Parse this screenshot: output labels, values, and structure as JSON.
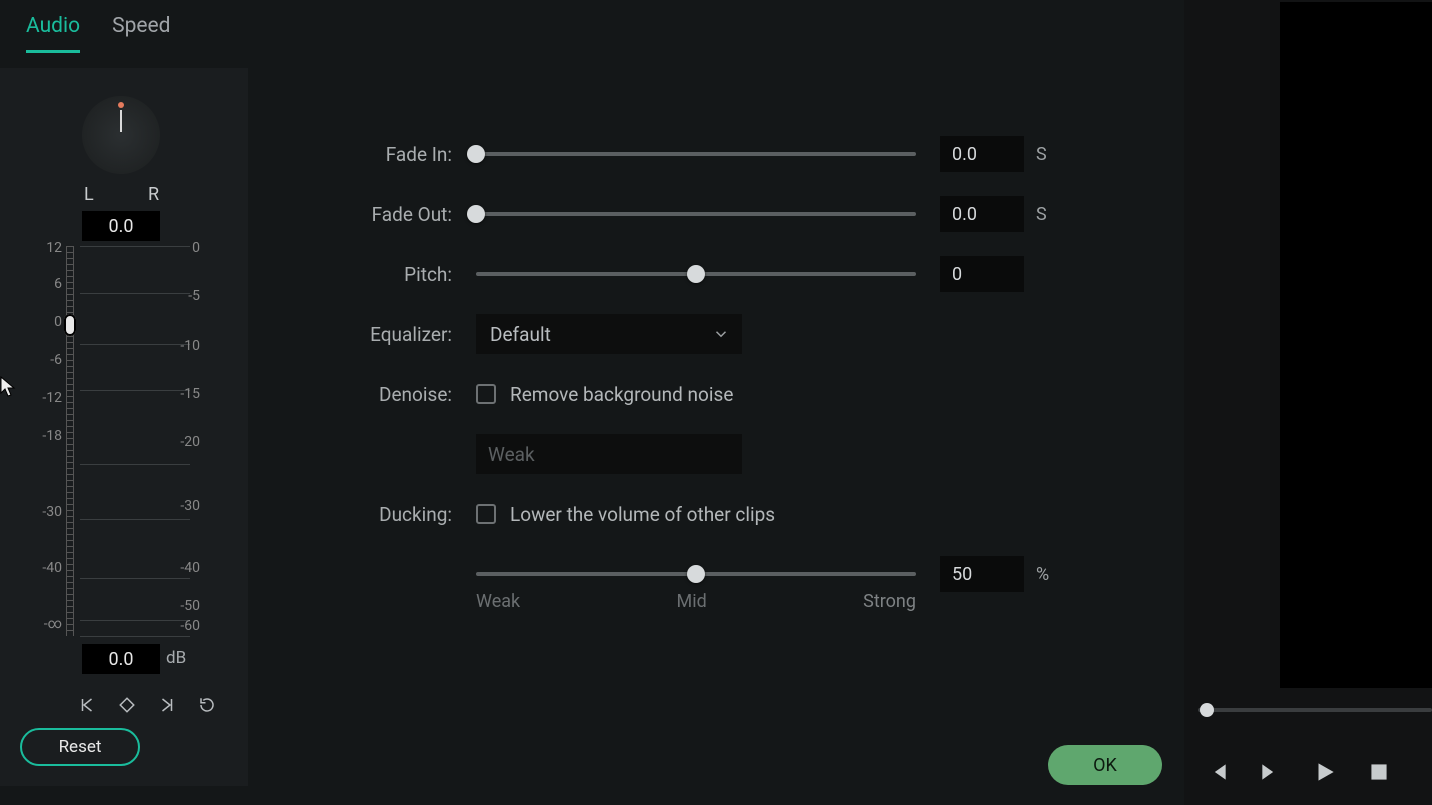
{
  "tabs": {
    "audio": "Audio",
    "speed": "Speed",
    "active": "audio"
  },
  "pan": {
    "l": "L",
    "r": "R",
    "value": "0.0"
  },
  "volume": {
    "value": "0.0",
    "unit": "dB",
    "ticks_left": [
      "12",
      "6",
      "0",
      "-6",
      "-12",
      "-18",
      "-30",
      "-40",
      "-∞"
    ],
    "ticks_right": [
      "0",
      "-5",
      "-10",
      "-15",
      "-20",
      "-30",
      "-40",
      "-50",
      "-60"
    ],
    "thumb_pct": 20
  },
  "reset": "Reset",
  "ok": "OK",
  "fade_in": {
    "label": "Fade In:",
    "value": "0.0",
    "unit": "S",
    "pos_pct": 0
  },
  "fade_out": {
    "label": "Fade Out:",
    "value": "0.0",
    "unit": "S",
    "pos_pct": 0
  },
  "pitch": {
    "label": "Pitch:",
    "value": "0",
    "pos_pct": 50
  },
  "equalizer": {
    "label": "Equalizer:",
    "value": "Default"
  },
  "denoise": {
    "label": "Denoise:",
    "check_label": "Remove background noise",
    "level": "Weak"
  },
  "ducking": {
    "label": "Ducking:",
    "check_label": "Lower the volume of other clips",
    "value": "50",
    "unit": "%",
    "pos_pct": 50,
    "marks": {
      "weak": "Weak",
      "mid": "Mid",
      "strong": "Strong"
    }
  },
  "player": {
    "seek_pct": 4
  }
}
